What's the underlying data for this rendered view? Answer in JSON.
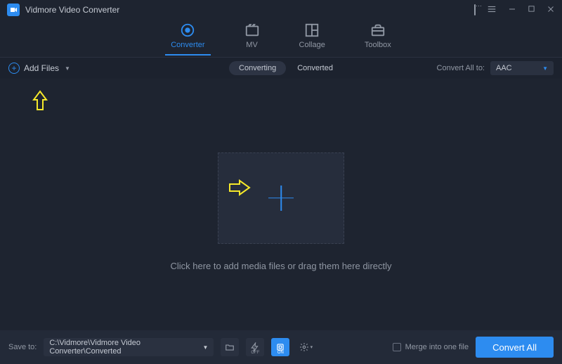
{
  "app": {
    "title": "Vidmore Video Converter"
  },
  "tabs": {
    "converter": "Converter",
    "mv": "MV",
    "collage": "Collage",
    "toolbox": "Toolbox"
  },
  "subbar": {
    "add_files": "Add Files",
    "converting": "Converting",
    "converted": "Converted",
    "convert_all_to": "Convert All to:",
    "format_selected": "AAC"
  },
  "dropzone": {
    "text": "Click here to add media files or drag them here directly"
  },
  "bottom": {
    "save_to": "Save to:",
    "path": "C:\\Vidmore\\Vidmore Video Converter\\Converted",
    "merge": "Merge into one file",
    "convert_all": "Convert All"
  }
}
